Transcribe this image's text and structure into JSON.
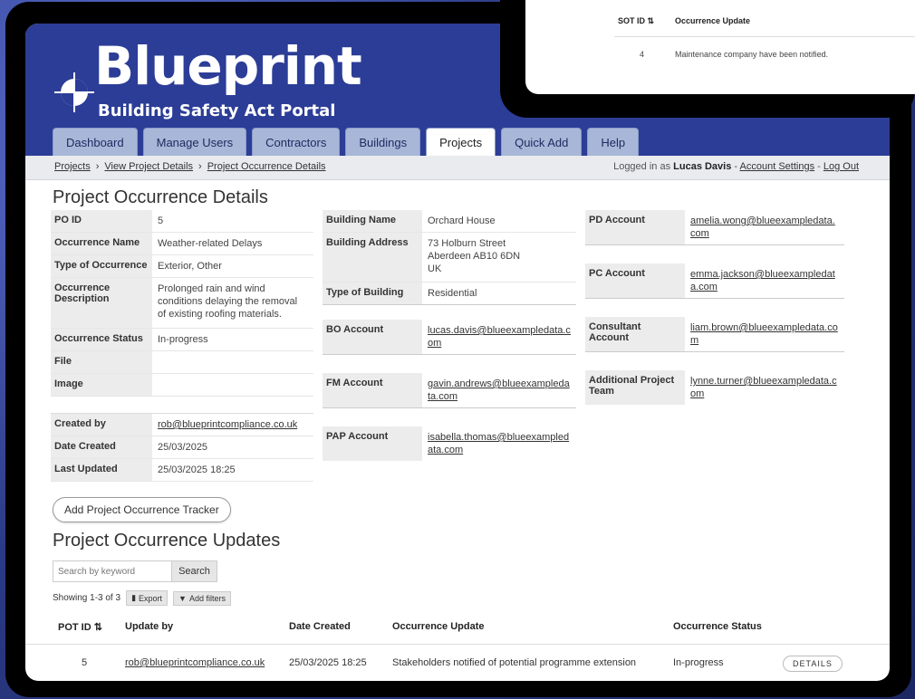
{
  "app": {
    "logo_title": "Blueprint",
    "logo_subtitle": "Building Safety Act Portal",
    "brand_color": "#2c3d97"
  },
  "nav": {
    "tabs": [
      {
        "label": "Dashboard"
      },
      {
        "label": "Manage Users"
      },
      {
        "label": "Contractors"
      },
      {
        "label": "Buildings"
      },
      {
        "label": "Projects",
        "active": true
      },
      {
        "label": "Quick Add"
      },
      {
        "label": "Help"
      }
    ]
  },
  "breadcrumb": [
    "Projects",
    "View Project Details",
    "Project Occurrence Details"
  ],
  "session": {
    "logged_in_prefix": "Logged in as",
    "user": "Lucas Davis",
    "account_settings": "Account Settings",
    "logout": "Log Out"
  },
  "details": {
    "title": "Project Occurrence Details",
    "left": [
      {
        "k": "PO ID",
        "v": "5"
      },
      {
        "k": "Occurrence Name",
        "v": "Weather-related Delays"
      },
      {
        "k": "Type of Occurrence",
        "v": "Exterior, Other"
      },
      {
        "k": "Occurrence Description",
        "v": "Prolonged rain and wind conditions delaying the removal of existing roofing materials."
      },
      {
        "k": "Occurrence Status",
        "v": "In-progress"
      },
      {
        "k": "File",
        "v": ""
      },
      {
        "k": "Image",
        "v": ""
      }
    ],
    "meta": [
      {
        "k": "Created by",
        "v": "rob@blueprintcompliance.co.uk",
        "link": true
      },
      {
        "k": "Date Created",
        "v": "25/03/2025"
      },
      {
        "k": "Last Updated",
        "v": "25/03/2025 18:25"
      }
    ],
    "middle": [
      {
        "k": "Building Name",
        "v": "Orchard House"
      },
      {
        "k": "Building Address",
        "v": "73 Holburn Street\nAberdeen AB10 6DN\nUK"
      },
      {
        "k": "Type of Building",
        "v": "Residential"
      },
      {
        "k": "BO Account",
        "v": "lucas.davis@blueexampledata.com",
        "link": true
      },
      {
        "k": "FM Account",
        "v": "gavin.andrews@blueexampledata.com",
        "link": true
      },
      {
        "k": "PAP Account",
        "v": "isabella.thomas@blueexampledata.com",
        "link": true
      }
    ],
    "right": [
      {
        "k": "PD Account",
        "v": "amelia.wong@blueexampledata.com",
        "link": true
      },
      {
        "k": "PC Account",
        "v": "emma.jackson@blueexampledata.com",
        "link": true
      },
      {
        "k": "Consultant Account",
        "v": "liam.brown@blueexampledata.com",
        "link": true
      },
      {
        "k": "Additional Project Team",
        "v": "lynne.turner@blueexampledata.com",
        "link": true
      }
    ]
  },
  "actions": {
    "add_tracker": "Add Project Occurrence Tracker"
  },
  "updates": {
    "title": "Project Occurrence Updates",
    "search_placeholder": "Search by keyword",
    "search_button": "Search",
    "showing": "Showing 1-3 of 3",
    "export": "Export",
    "add_filters": "Add filters",
    "columns": [
      "POT ID",
      "Update by",
      "Date Created",
      "Occurrence Update",
      "Occurrence Status"
    ],
    "rows": [
      {
        "id": "5",
        "by": "rob@blueprintcompliance.co.uk",
        "date": "25/03/2025 18:25",
        "update": "Stakeholders notified of potential programme extension",
        "status": "In-progress",
        "action": "DETAILS"
      }
    ]
  },
  "popup": {
    "columns": [
      "SOT ID",
      "Occurrence Update"
    ],
    "row": {
      "id": "4",
      "update": "Maintenance company have been notified."
    }
  }
}
